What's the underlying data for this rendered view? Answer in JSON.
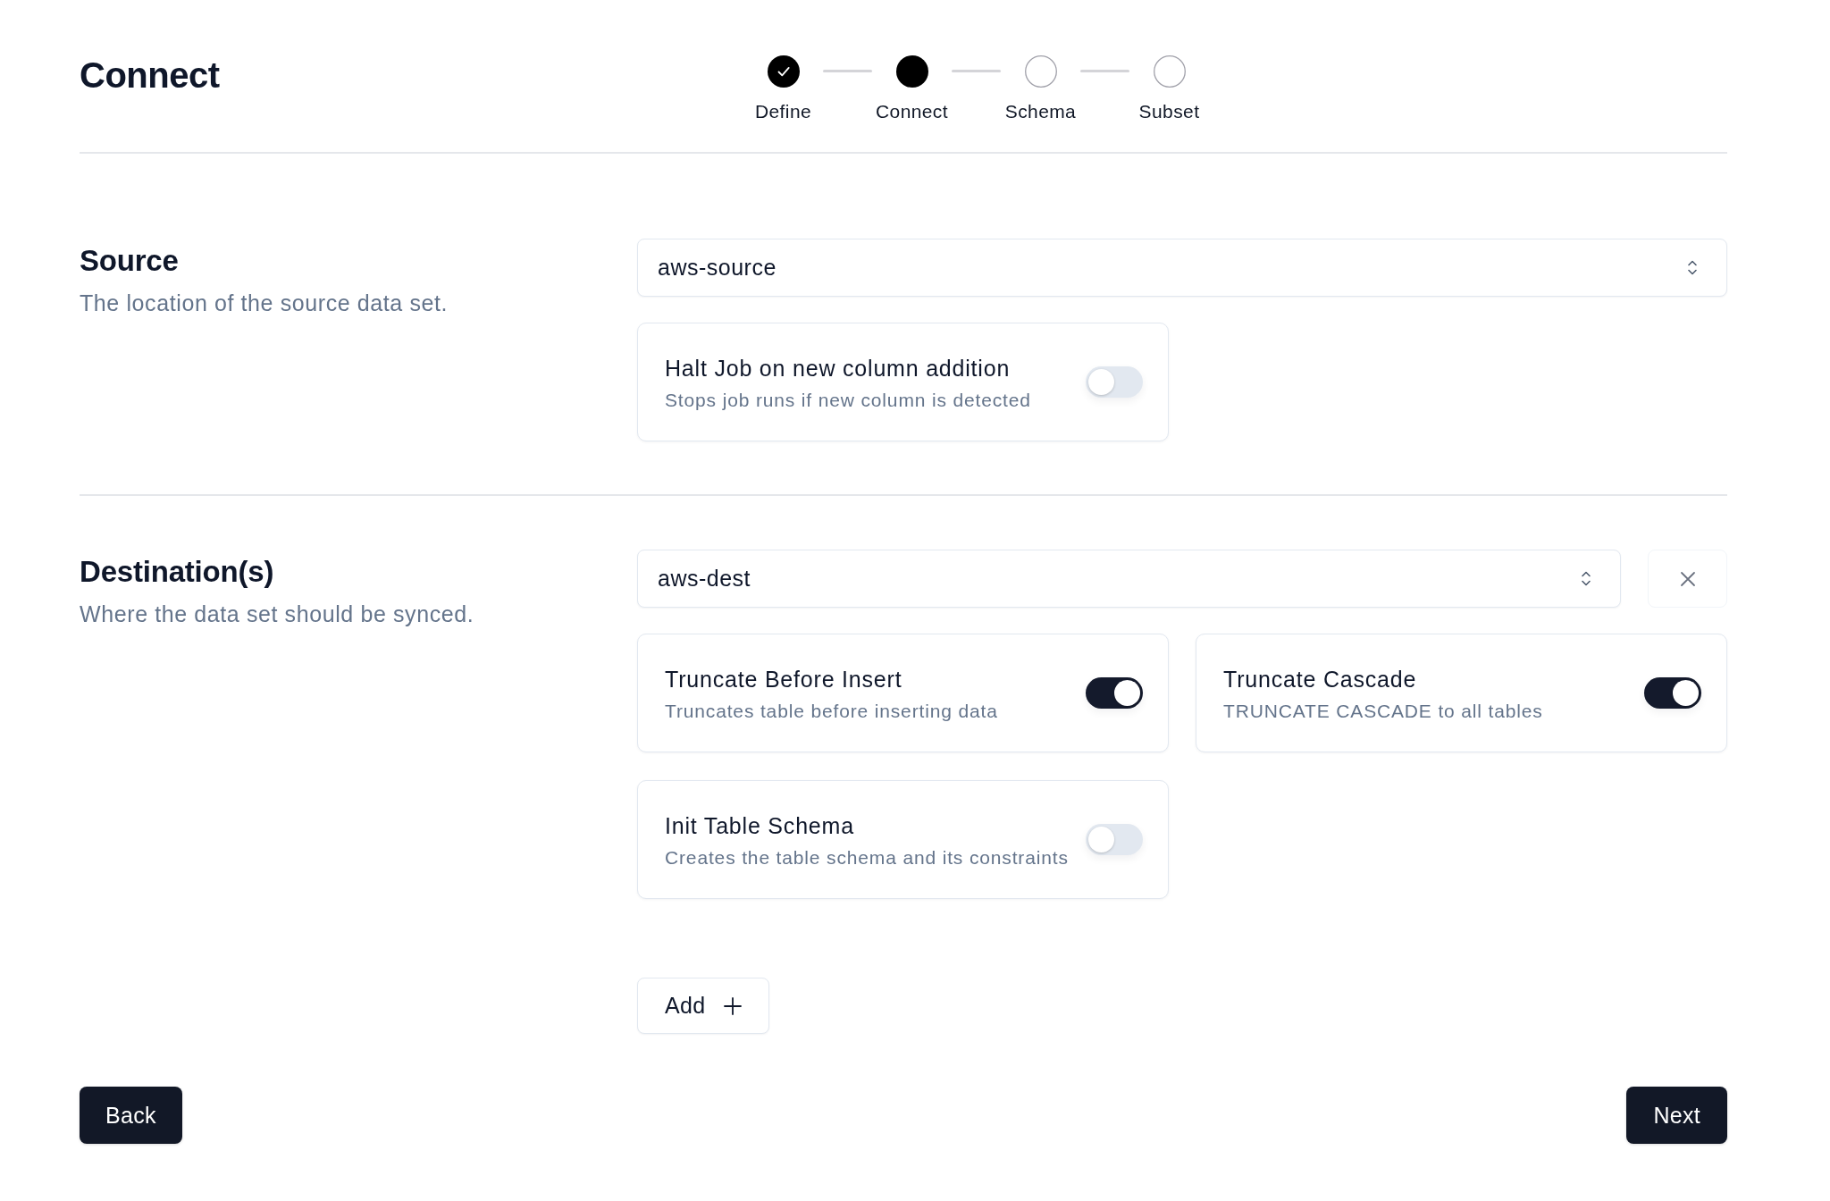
{
  "page_title": "Connect",
  "stepper": {
    "steps": [
      {
        "label": "Define",
        "kind": "done"
      },
      {
        "label": "Connect",
        "kind": "current"
      },
      {
        "label": "Schema",
        "kind": "todo"
      },
      {
        "label": "Subset",
        "kind": "todo"
      }
    ]
  },
  "source": {
    "heading": "Source",
    "description": "The location of the source data set.",
    "select": {
      "value": "aws-source"
    },
    "options": [
      {
        "title": "Halt Job on new column addition",
        "description": "Stops job runs if new column is detected",
        "on": false
      }
    ]
  },
  "destinations": {
    "heading": "Destination(s)",
    "description": "Where the data set should be synced.",
    "items": [
      {
        "select": {
          "value": "aws-dest"
        },
        "options": [
          {
            "title": "Truncate Before Insert",
            "description": "Truncates table before inserting data",
            "on": true
          },
          {
            "title": "Truncate Cascade",
            "description": "TRUNCATE CASCADE to all tables",
            "on": true
          },
          {
            "title": "Init Table Schema",
            "description": "Creates the table schema and its constraints",
            "on": false
          }
        ]
      }
    ],
    "add_button": "Add"
  },
  "footer": {
    "back": "Back",
    "next": "Next"
  }
}
